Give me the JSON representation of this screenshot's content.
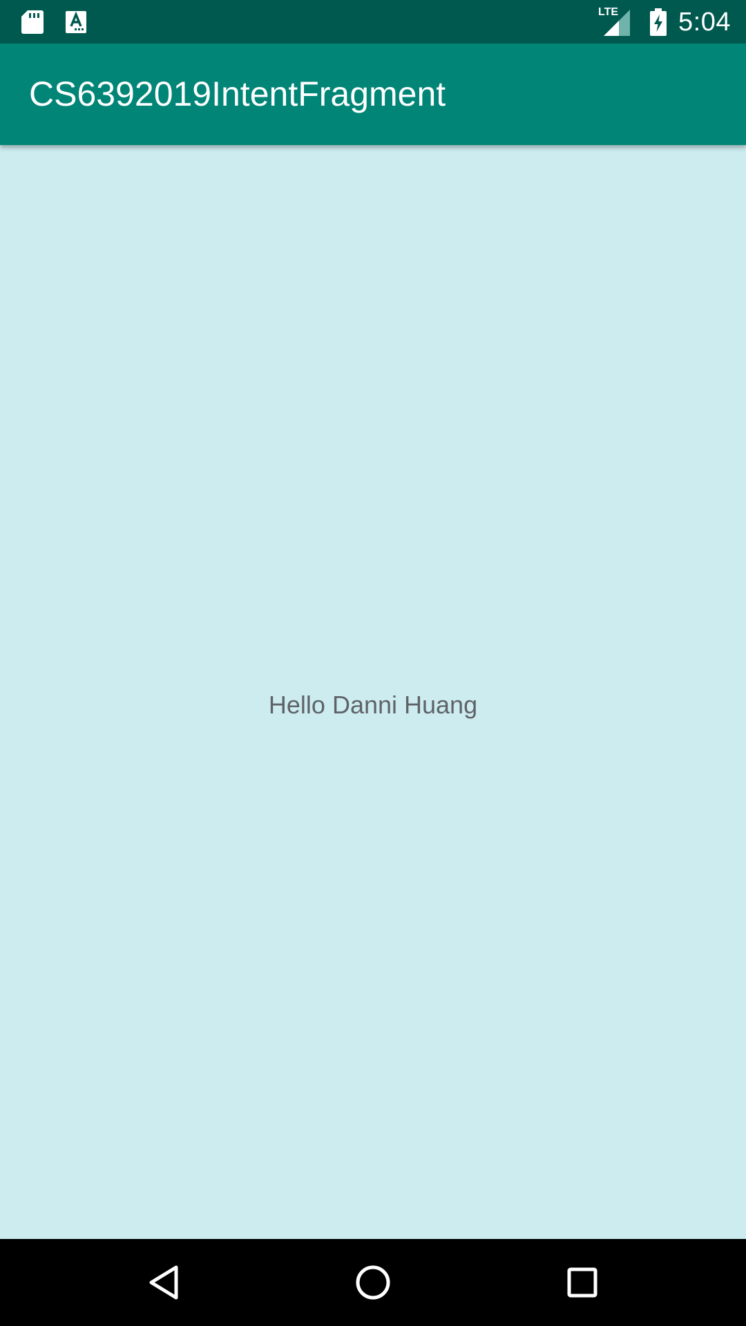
{
  "status_bar": {
    "left_icons": [
      "sd-card-icon",
      "keyboard-a-icon"
    ],
    "network_label": "LTE",
    "right_icons": [
      "signal-icon",
      "battery-charging-icon"
    ],
    "time": "5:04"
  },
  "app_bar": {
    "title": "CS6392019IntentFragment"
  },
  "main": {
    "greeting": "Hello Danni Huang"
  },
  "nav_bar": {
    "buttons": [
      "back-icon",
      "home-icon",
      "recents-icon"
    ]
  },
  "colors": {
    "status_bar": "#00594f",
    "app_bar": "#008577",
    "background": "#cdecef",
    "text": "#5f6368",
    "nav_bar": "#000000"
  }
}
